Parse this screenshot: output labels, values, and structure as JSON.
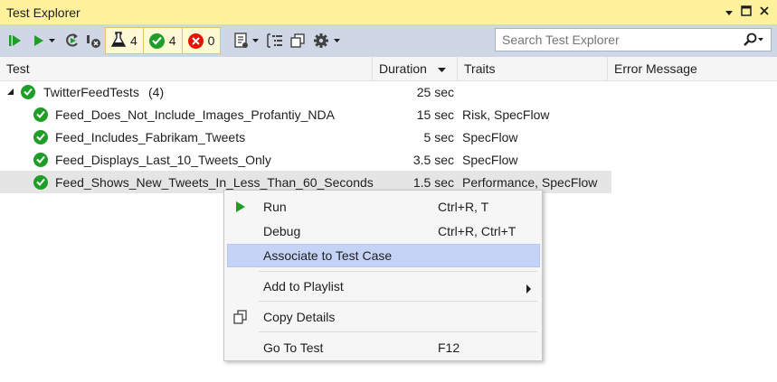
{
  "window": {
    "title": "Test Explorer"
  },
  "toolbar": {
    "filters": [
      {
        "icon": "flask-icon",
        "count": "4"
      },
      {
        "icon": "passed-icon",
        "count": "4"
      },
      {
        "icon": "failed-icon",
        "count": "0"
      }
    ],
    "search_placeholder": "Search Test Explorer"
  },
  "columns": {
    "test": "Test",
    "duration": "Duration",
    "traits": "Traits",
    "error": "Error Message"
  },
  "group": {
    "name": "TwitterFeedTests",
    "count": "(4)",
    "duration": "25 sec"
  },
  "tests": [
    {
      "name": "Feed_Does_Not_Include_Images_Profantiy_NDA",
      "duration": "15 sec",
      "traits": "Risk, SpecFlow"
    },
    {
      "name": "Feed_Includes_Fabrikam_Tweets",
      "duration": "5 sec",
      "traits": "SpecFlow"
    },
    {
      "name": "Feed_Displays_Last_10_Tweets_Only",
      "duration": "3.5 sec",
      "traits": "SpecFlow"
    },
    {
      "name": "Feed_Shows_New_Tweets_In_Less_Than_60_Seconds",
      "duration": "1.5 sec",
      "traits": "Performance, SpecFlow"
    }
  ],
  "context_menu": {
    "run": {
      "label": "Run",
      "shortcut": "Ctrl+R, T"
    },
    "debug": {
      "label": "Debug",
      "shortcut": "Ctrl+R, Ctrl+T"
    },
    "associate": {
      "label": "Associate to Test Case"
    },
    "playlist": {
      "label": "Add to Playlist"
    },
    "copy": {
      "label": "Copy Details"
    },
    "goto": {
      "label": "Go To Test",
      "shortcut": "F12"
    }
  },
  "colors": {
    "title_bar": "#fff29d",
    "toolbar": "#cfd6e5",
    "passed": "#1f9e27",
    "failed": "#e51400",
    "highlight": "#c5d4f6"
  }
}
